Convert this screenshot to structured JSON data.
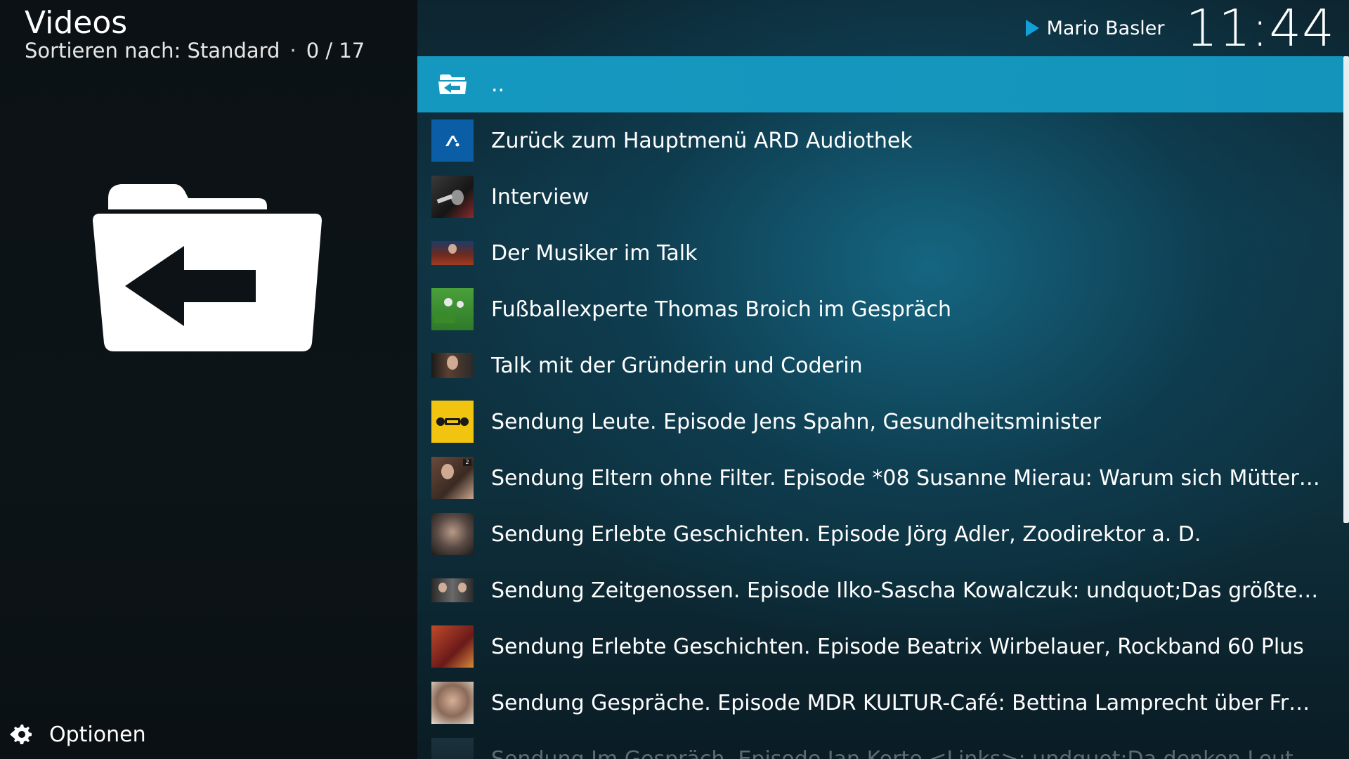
{
  "header": {
    "title": "Videos",
    "sort_label": "Sortieren nach: Standard",
    "separator": "·",
    "count": "0 / 17"
  },
  "left": {
    "icon": "folder-back-icon"
  },
  "options": {
    "icon": "options-gear-icon",
    "label": "Optionen"
  },
  "topbar": {
    "play_icon": "play-icon",
    "now_playing": "Mario Basler",
    "clock": "11:44"
  },
  "list": {
    "items": [
      {
        "label": "..",
        "icon": "parent-folder-icon"
      },
      {
        "label": "Zurück zum Hauptmenü ARD Audiothek",
        "icon": "ard-audiothek-logo"
      },
      {
        "label": "Interview",
        "icon": "interview-thumbnail"
      },
      {
        "label": "Der Musiker im Talk",
        "icon": "musiker-thumbnail"
      },
      {
        "label": "Fußballexperte Thomas Broich im Gespräch",
        "icon": "fussball-thumbnail"
      },
      {
        "label": "Talk mit der Gründerin und Coderin",
        "icon": "gruenderin-thumbnail"
      },
      {
        "label": "Sendung Leute. Episode Jens Spahn, Gesundheitsminister",
        "icon": "leute-thumbnail"
      },
      {
        "label": "Sendung Eltern ohne Filter. Episode *08 Susanne Mierau: Warum sich Mütter um ...",
        "icon": "eltern-thumbnail"
      },
      {
        "label": "Sendung Erlebte Geschichten. Episode Jörg Adler, Zoodirektor a. D.",
        "icon": "adler-thumbnail"
      },
      {
        "label": "Sendung Zeitgenossen. Episode Ilko-Sascha Kowalczuk: undquot;Das größte Glück...",
        "icon": "zeitgenossen-thumbnail"
      },
      {
        "label": "Sendung Erlebte Geschichten. Episode Beatrix Wirbelauer, Rockband 60 Plus",
        "icon": "wirbelauer-thumbnail"
      },
      {
        "label": "Sendung Gespräche. Episode MDR KULTUR-Café: Bettina Lamprecht über Frauen i...",
        "icon": "lamprecht-thumbnail"
      },
      {
        "label": "Sendung Im Gespräch. Episode Jan Korte <Links>: undquot;Da denken Leute natü...",
        "icon": "korte-thumbnail"
      }
    ]
  },
  "colors": {
    "selected_row": "#1598c0",
    "accent_play": "#12a0d8",
    "background_left": "#0c1216"
  }
}
